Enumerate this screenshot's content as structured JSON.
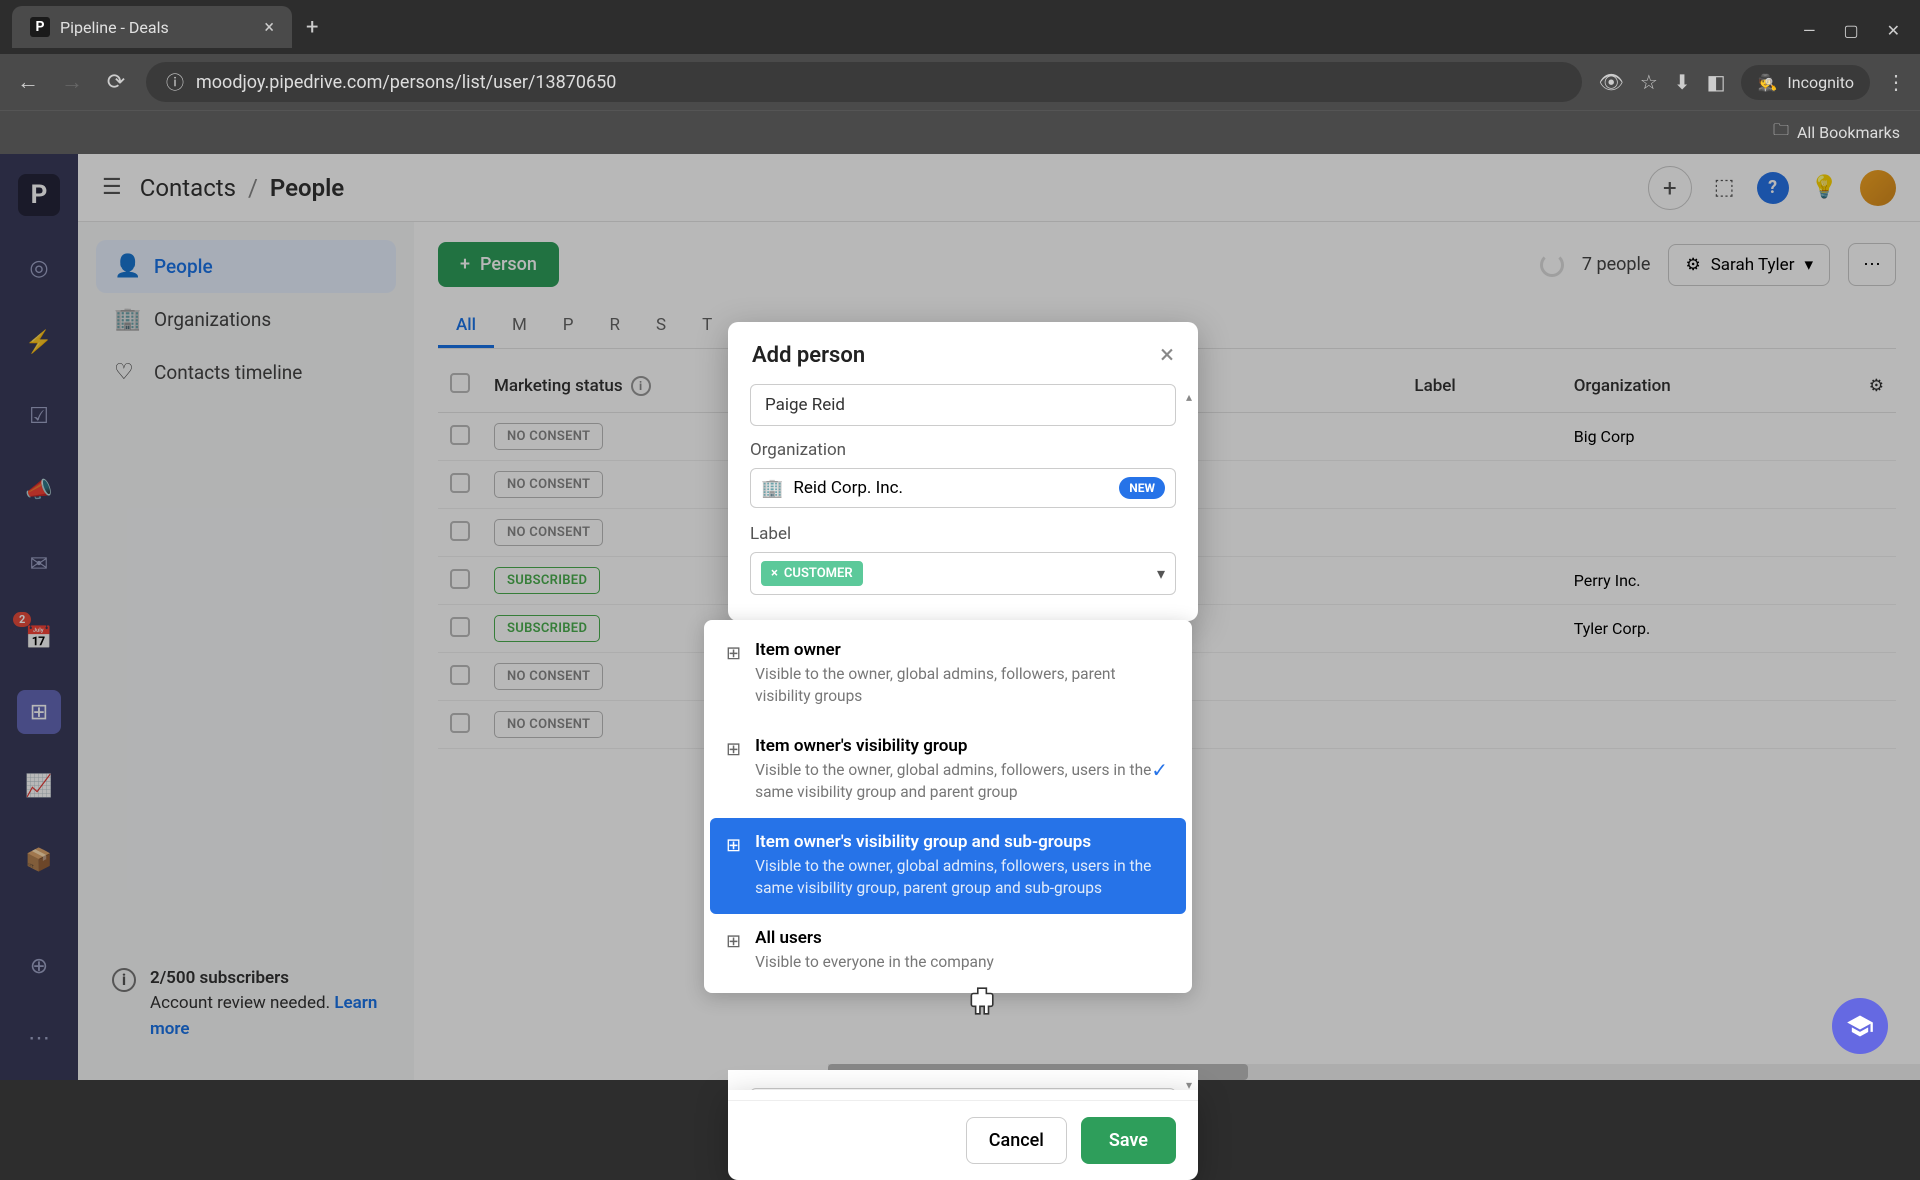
{
  "browser": {
    "tab_title": "Pipeline - Deals",
    "url": "moodjoy.pipedrive.com/persons/list/user/13870650",
    "incognito": "Incognito",
    "all_bookmarks": "All Bookmarks"
  },
  "header": {
    "breadcrumb_root": "Contacts",
    "breadcrumb_current": "People"
  },
  "sidebar": {
    "items": [
      {
        "label": "People"
      },
      {
        "label": "Organizations"
      },
      {
        "label": "Contacts timeline"
      }
    ],
    "footer": {
      "subscribers": "2/500 subscribers",
      "review": "Account review needed.",
      "learn_more": "Learn more"
    }
  },
  "rail_badge": "2",
  "toolbar": {
    "add_person": "Person",
    "people_count": "7 people",
    "filter_user": "Sarah Tyler"
  },
  "tabs": [
    "All",
    "M",
    "P",
    "R",
    "S",
    "T"
  ],
  "table": {
    "headers": {
      "marketing": "Marketing status",
      "label": "Label",
      "org": "Organization"
    },
    "rows": [
      {
        "status": "NO CONSENT",
        "status_type": "no-consent",
        "org": "Big Corp"
      },
      {
        "status": "NO CONSENT",
        "status_type": "no-consent",
        "org": ""
      },
      {
        "status": "NO CONSENT",
        "status_type": "no-consent",
        "org": ""
      },
      {
        "status": "SUBSCRIBED",
        "status_type": "subscribed",
        "org": "Perry Inc."
      },
      {
        "status": "SUBSCRIBED",
        "status_type": "subscribed",
        "org": "Tyler Corp."
      },
      {
        "status": "NO CONSENT",
        "status_type": "no-consent",
        "org": ""
      },
      {
        "status": "NO CONSENT",
        "status_type": "no-consent",
        "org": ""
      }
    ]
  },
  "modal": {
    "title": "Add person",
    "name_value": "Paige Reid",
    "org_label": "Organization",
    "org_value": "Reid Corp. Inc.",
    "new_badge": "NEW",
    "label_label": "Label",
    "label_chip": "CUSTOMER",
    "visibility_value": "Item owner's visibility group",
    "cancel": "Cancel",
    "save": "Save"
  },
  "dropdown": {
    "options": [
      {
        "title": "Item owner",
        "desc": "Visible to the owner, global admins, followers, parent visibility groups"
      },
      {
        "title": "Item owner's visibility group",
        "desc": "Visible to the owner, global admins, followers, users in the same visibility group and parent group"
      },
      {
        "title": "Item owner's visibility group and sub-groups",
        "desc": "Visible to the owner, global admins, followers, users in the same visibility group, parent group and sub-groups"
      },
      {
        "title": "All users",
        "desc": "Visible to everyone in the company"
      }
    ]
  }
}
